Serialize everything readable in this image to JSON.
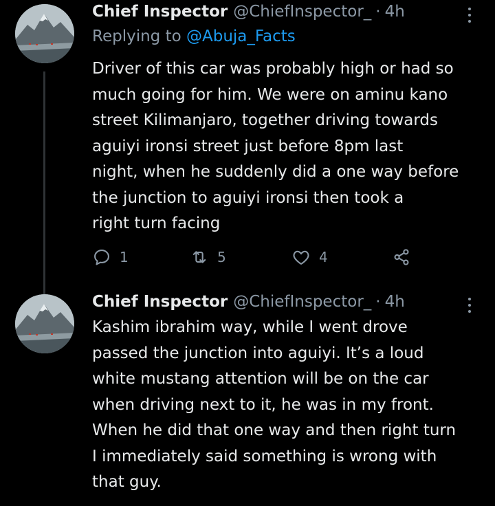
{
  "tweets": [
    {
      "author_name": "Chief Inspector",
      "handle": "@ChiefInspector_",
      "separator": "·",
      "time": "4h",
      "reply_prefix": "Replying to",
      "reply_mention": "@Abuja_Facts",
      "text": "Driver of this car was probably high or had so\nmuch going for him. We were on aminu kano\nstreet Kilimanjaro, together driving towards\naguiyi ironsi street just before 8pm last\nnight, when he suddenly did a one way before\nthe junction to aguiyi ironsi then took a\nright turn facing",
      "reply_count": "1",
      "retweet_count": "5",
      "like_count": "4"
    },
    {
      "author_name": "Chief Inspector",
      "handle": "@ChiefInspector_",
      "separator": "·",
      "time": "4h",
      "text": "Kashim ibrahim way, while I went drove\npassed the junction into aguiyi. It’s a loud\nwhite mustang attention will be on the car\nwhen driving next to it, he was in my front.\nWhen he did that one way and then right turn\nI immediately said something is wrong with\nthat guy."
    }
  ],
  "icons": {
    "reply": "reply-icon",
    "retweet": "retweet-icon",
    "like": "heart-icon",
    "share": "share-icon",
    "more": "more-options-icon"
  },
  "colors": {
    "background": "#000000",
    "text": "#e7e9ea",
    "secondary": "#8b98a5",
    "accent": "#1d9bf0"
  }
}
